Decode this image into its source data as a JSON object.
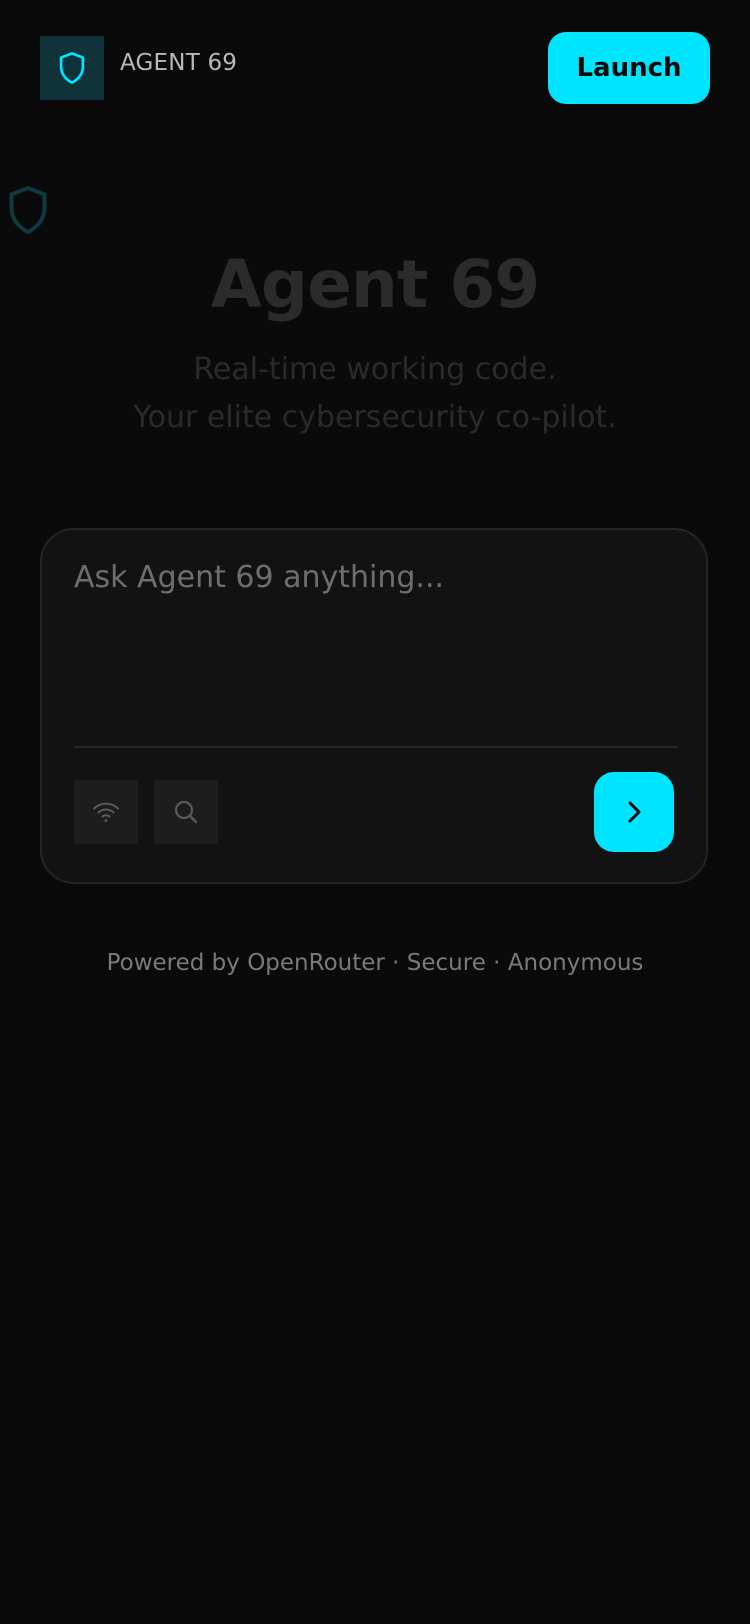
{
  "header": {
    "brand_name": "AGENT 69",
    "launch_label": "Launch"
  },
  "hero": {
    "title": "Agent 69",
    "line1": "Real-time working code.",
    "line2": "Your elite cybersecurity co-pilot."
  },
  "chat": {
    "placeholder": "Ask Agent 69 anything...",
    "value": "",
    "tools": [
      {
        "icon": "wifi-icon"
      },
      {
        "icon": "search-icon"
      }
    ],
    "send_icon": "chevron-right-icon"
  },
  "footer": {
    "note": "Powered by OpenRouter · Secure · Anonymous"
  },
  "colors": {
    "background": "#0a0a0a",
    "accent": "#00e5ff",
    "card": "#121212",
    "logo_bg": "#0f3338"
  }
}
